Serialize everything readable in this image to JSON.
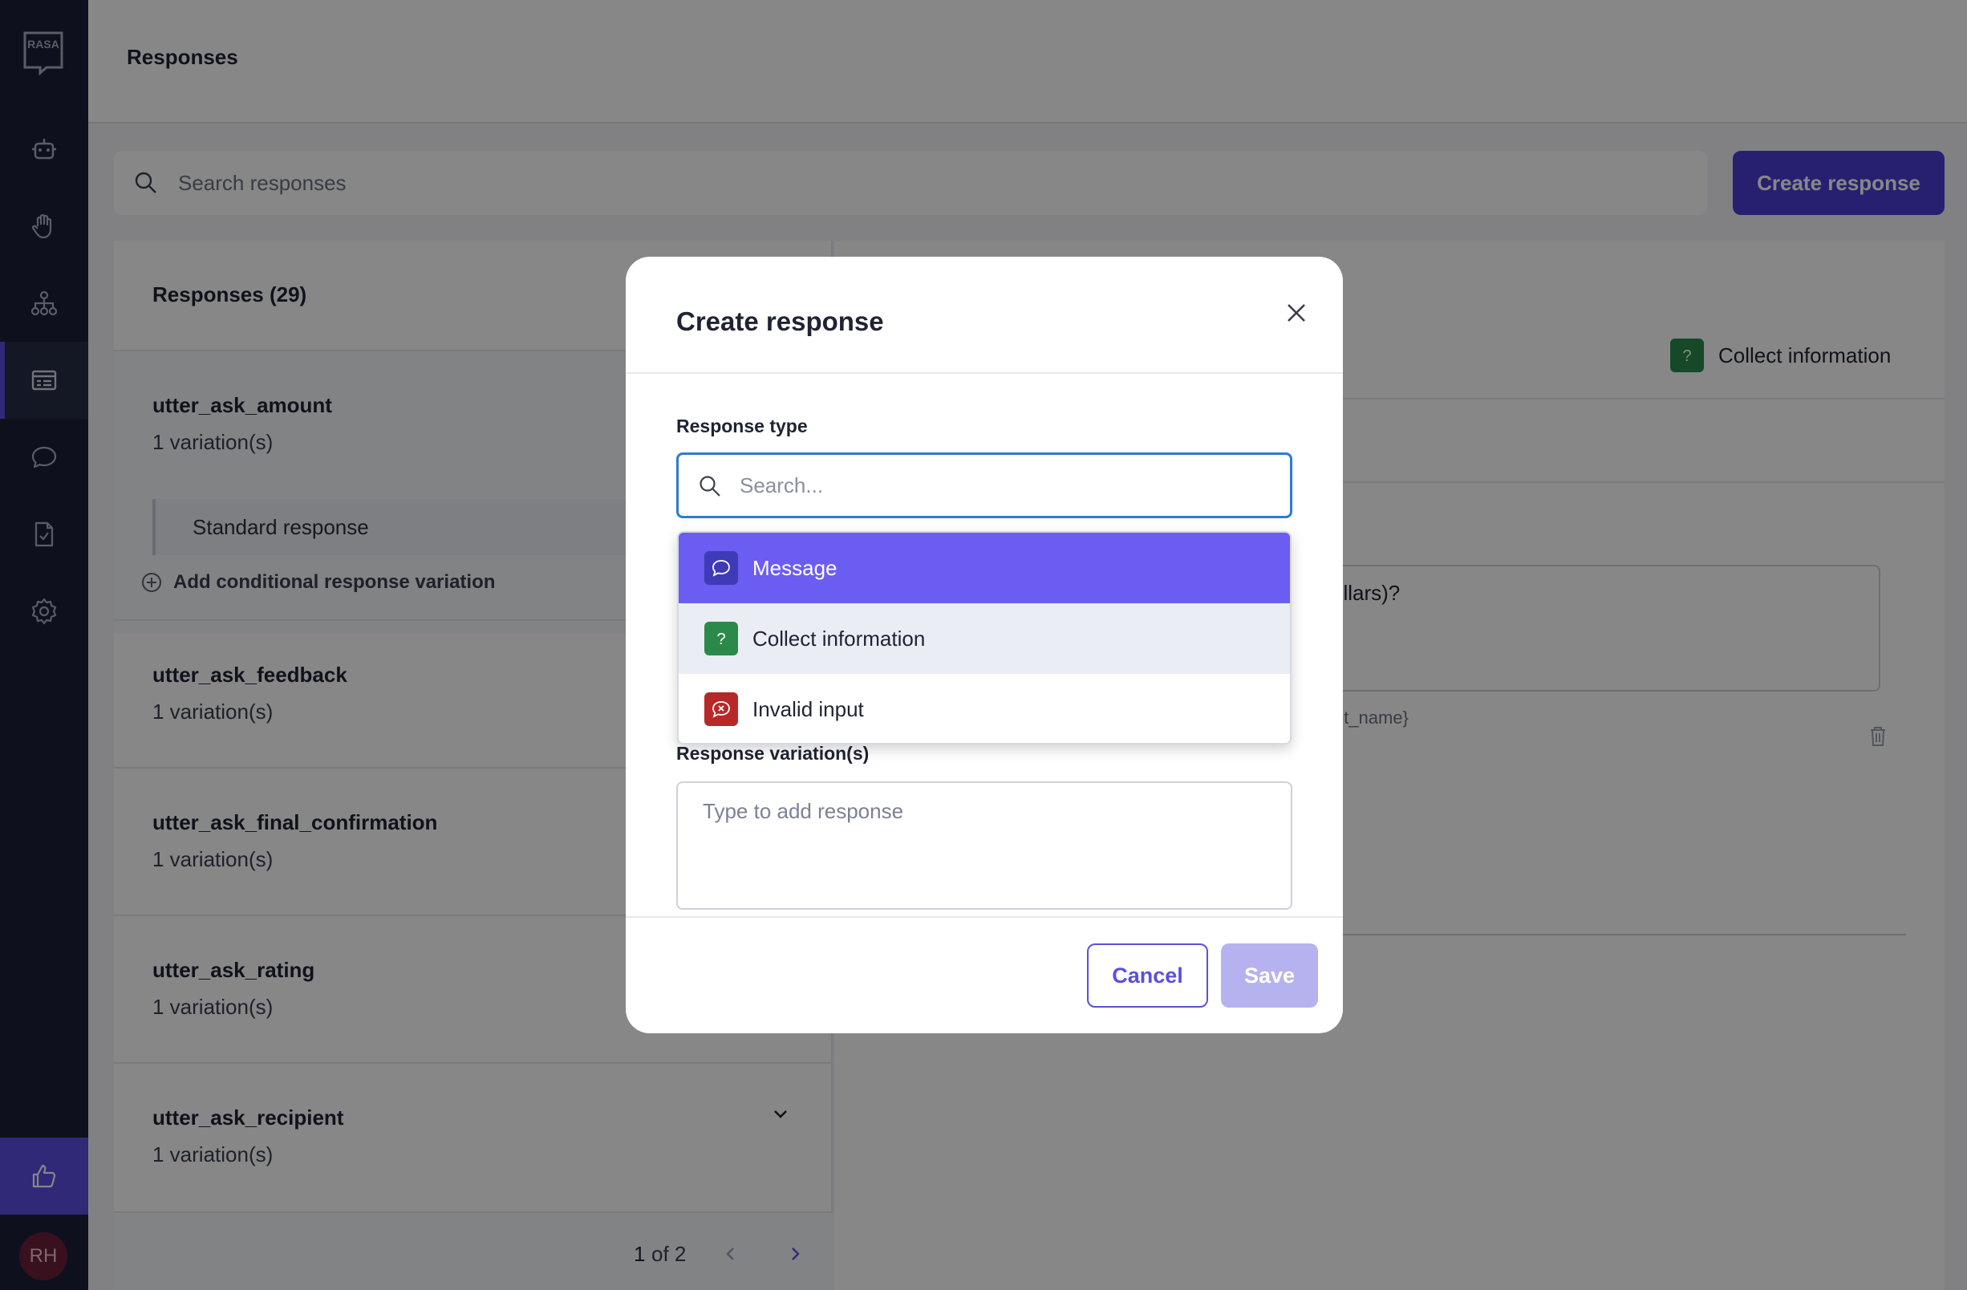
{
  "app": {
    "logo_text": "RASA",
    "page_title": "Responses",
    "nav_items": [
      {
        "icon": "robot-icon",
        "name": "nav-assistant"
      },
      {
        "icon": "hand-icon",
        "name": "nav-intents"
      },
      {
        "icon": "flow-icon",
        "name": "nav-flows"
      },
      {
        "icon": "responses-icon",
        "name": "nav-responses"
      },
      {
        "icon": "chat-icon",
        "name": "nav-conversations"
      },
      {
        "icon": "document-check-icon",
        "name": "nav-tests"
      },
      {
        "icon": "gear-icon",
        "name": "nav-settings"
      }
    ],
    "avatar_initials": "RH"
  },
  "search": {
    "placeholder": "Search responses"
  },
  "create_button_label": "Create response",
  "list": {
    "header": "Responses (29)",
    "items": [
      {
        "name": "utter_ask_amount",
        "count": "1 variation(s)"
      },
      {
        "name": "utter_ask_feedback",
        "count": "1 variation(s)"
      },
      {
        "name": "utter_ask_final_confirmation",
        "count": "1 variation(s)"
      },
      {
        "name": "utter_ask_rating",
        "count": "1 variation(s)"
      },
      {
        "name": "utter_ask_recipient",
        "count": "1 variation(s)"
      }
    ],
    "standard_response": "Standard response",
    "add_conditional": "Add conditional response variation",
    "pagination": {
      "current": "1",
      "of_total": "of 2"
    }
  },
  "detail": {
    "type_label": "Collect information",
    "text_fragment": "ollars)?",
    "hint_fragment": "lot_name}"
  },
  "modal": {
    "title": "Create response",
    "type_label": "Response type",
    "type_search_placeholder": "Search...",
    "options": [
      {
        "label": "Message",
        "icon": "message-icon",
        "color": "#3e3ab8"
      },
      {
        "label": "Collect information",
        "icon": "question-icon",
        "color": "#2b8a4a"
      },
      {
        "label": "Invalid input",
        "icon": "invalid-icon",
        "color": "#b8282a"
      }
    ],
    "variation_label": "Response variation(s)",
    "variation_placeholder": "Type to add response",
    "cancel_label": "Cancel",
    "save_label": "Save"
  }
}
